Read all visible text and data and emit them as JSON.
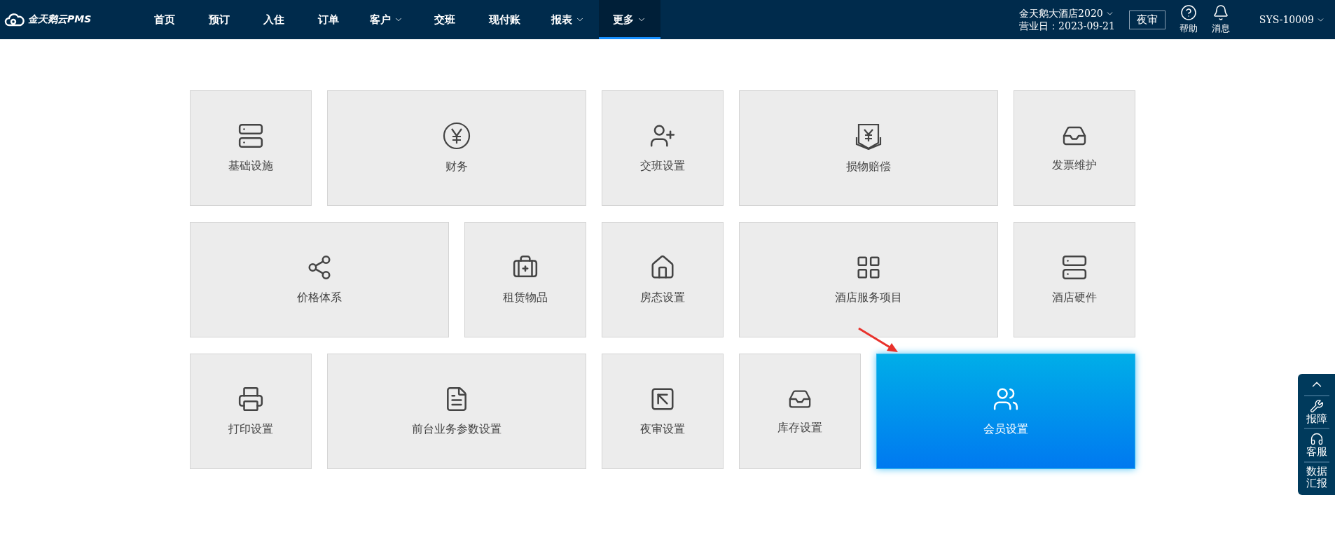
{
  "brand": "金天鹅云PMS",
  "nav": [
    {
      "label": "首页",
      "dropdown": false,
      "selected": false
    },
    {
      "label": "预订",
      "dropdown": false,
      "selected": false
    },
    {
      "label": "入住",
      "dropdown": false,
      "selected": false
    },
    {
      "label": "订单",
      "dropdown": false,
      "selected": false
    },
    {
      "label": "客户",
      "dropdown": true,
      "selected": false
    },
    {
      "label": "交班",
      "dropdown": false,
      "selected": false
    },
    {
      "label": "现付账",
      "dropdown": false,
      "selected": false
    },
    {
      "label": "报表",
      "dropdown": true,
      "selected": false
    },
    {
      "label": "更多",
      "dropdown": true,
      "selected": true
    }
  ],
  "hotel": {
    "name": "金天鹅大酒店2020",
    "business_day": "营业日：2023-09-21"
  },
  "night_audit_button": "夜审",
  "help": "帮助",
  "messages": "消息",
  "user": "SYS-10009",
  "tiles": [
    {
      "label": "基础设施",
      "selected": false
    },
    {
      "label": "财务",
      "selected": false
    },
    {
      "label": "交班设置",
      "selected": false
    },
    {
      "label": "损物赔偿",
      "selected": false
    },
    {
      "label": "发票维护",
      "selected": false
    },
    {
      "label": "价格体系",
      "selected": false
    },
    {
      "label": "租赁物品",
      "selected": false
    },
    {
      "label": "房态设置",
      "selected": false
    },
    {
      "label": "酒店服务项目",
      "selected": false
    },
    {
      "label": "酒店硬件",
      "selected": false
    },
    {
      "label": "打印设置",
      "selected": false
    },
    {
      "label": "前台业务参数设置",
      "selected": false
    },
    {
      "label": "夜审设置",
      "selected": false
    },
    {
      "label": "库存设置",
      "selected": false
    },
    {
      "label": "会员设置",
      "selected": true
    }
  ],
  "side_panel": [
    "报障",
    "客服",
    "数据汇报"
  ]
}
